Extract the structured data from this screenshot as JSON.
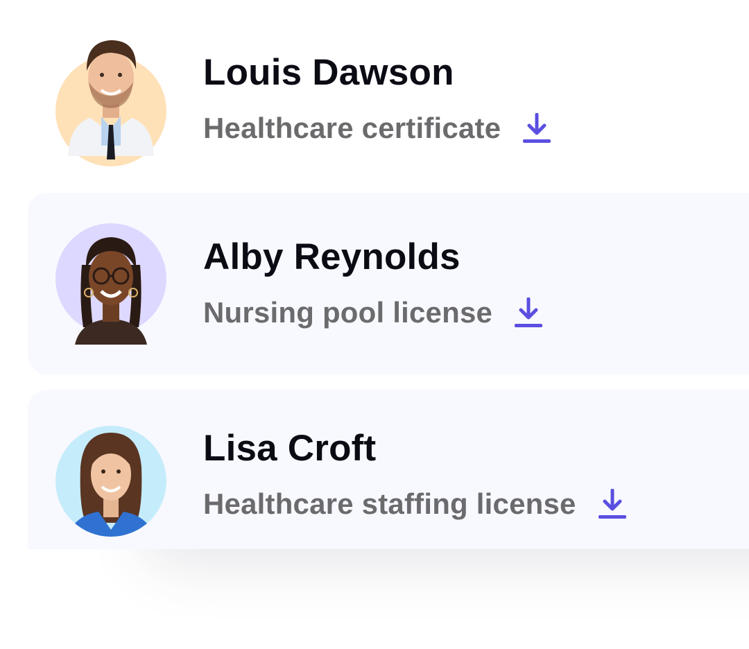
{
  "accent_color": "#5b4fe0",
  "people": [
    {
      "name": "Louis Dawson",
      "document": "Healthcare certificate",
      "action_icon": "download-icon",
      "avatar_bg": "#ffe1b8"
    },
    {
      "name": "Alby Reynolds",
      "document": "Nursing pool license",
      "action_icon": "download-icon",
      "avatar_bg": "#ddd8ff"
    },
    {
      "name": "Lisa Croft",
      "document": "Healthcare staffing license",
      "action_icon": "download-icon",
      "avatar_bg": "#c5ecfb"
    }
  ]
}
